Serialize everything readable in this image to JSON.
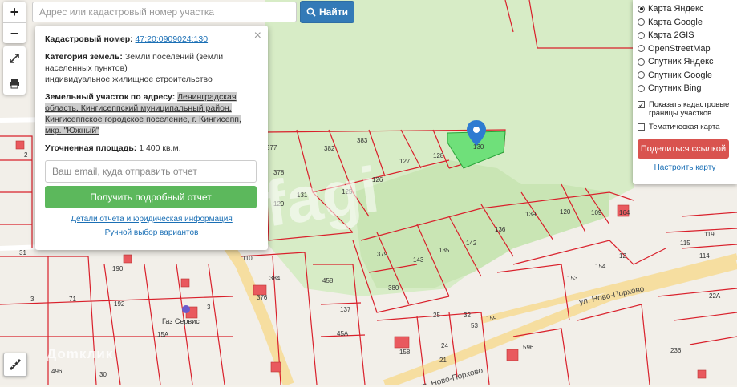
{
  "search": {
    "placeholder": "Адрес или кадастровый номер участка",
    "button_label": "Найти"
  },
  "zoom": {
    "in_label": "+",
    "out_label": "−"
  },
  "popup": {
    "close_label": "×",
    "cadastral_label": "Кадастровый номер:",
    "cadastral_value": "47:20:0909024:130",
    "category_label": "Категория земель:",
    "category_value": "Земли поселений (земли населенных пунктов)",
    "usage_value": "индивидуальное жилищное строительство",
    "address_label": "Земельный участок по адресу:",
    "address_value": "Ленинградская область, Кингисеппский муниципальный район, Кингисеппское городское поселение, г. Кингисепп, мкр. \"Южный\"",
    "area_label": "Уточненная площадь:",
    "area_value": "1 400 кв.м.",
    "email_placeholder": "Ваш email, куда отправить отчет",
    "report_button": "Получить подробный отчет",
    "details_link": "Детали отчета и юридическая информация",
    "manual_link": "Ручной выбор вариантов"
  },
  "layers": {
    "options": [
      {
        "label": "Карта Яндекс",
        "selected": true
      },
      {
        "label": "Карта Google",
        "selected": false
      },
      {
        "label": "Карта 2GIS",
        "selected": false
      },
      {
        "label": "OpenStreetMap",
        "selected": false
      },
      {
        "label": "Спутник Яндекс",
        "selected": false
      },
      {
        "label": "Спутник Google",
        "selected": false
      },
      {
        "label": "Спутник Bing",
        "selected": false
      }
    ],
    "show_borders_label": "Показать кадастровые границы участков",
    "show_borders_checked": true,
    "thematic_label": "Тематическая карта",
    "thematic_checked": false,
    "share_button": "Поделиться ссылкой",
    "setup_link": "Настроить карту"
  },
  "map": {
    "streets": [
      "ул. Ново-Порхово",
      "ул. Ново-Порхово"
    ],
    "poi": "Газ Сервис",
    "watermark": "Доmклик",
    "center_watermark": "fagi",
    "plot_numbers": [
      "377",
      "382",
      "383",
      "127",
      "128",
      "130",
      "378",
      "125",
      "126",
      "379",
      "143",
      "135",
      "142",
      "136",
      "139",
      "120",
      "109",
      "164",
      "380",
      "131",
      "129",
      "119",
      "115",
      "114",
      "12",
      "153",
      "154",
      "176",
      "110",
      "384",
      "458",
      "137",
      "45А",
      "25",
      "32",
      "53",
      "24",
      "21",
      "158",
      "159",
      "596",
      "71",
      "192",
      "190",
      "3",
      "3",
      "15А",
      "496",
      "22А",
      "236",
      "31",
      "376",
      "2",
      "30"
    ],
    "colors": {
      "selected_plot": "#6fe07a",
      "boundary": "#d9202b",
      "park": "#d7ecc6",
      "road": "#f7e3a8"
    }
  }
}
